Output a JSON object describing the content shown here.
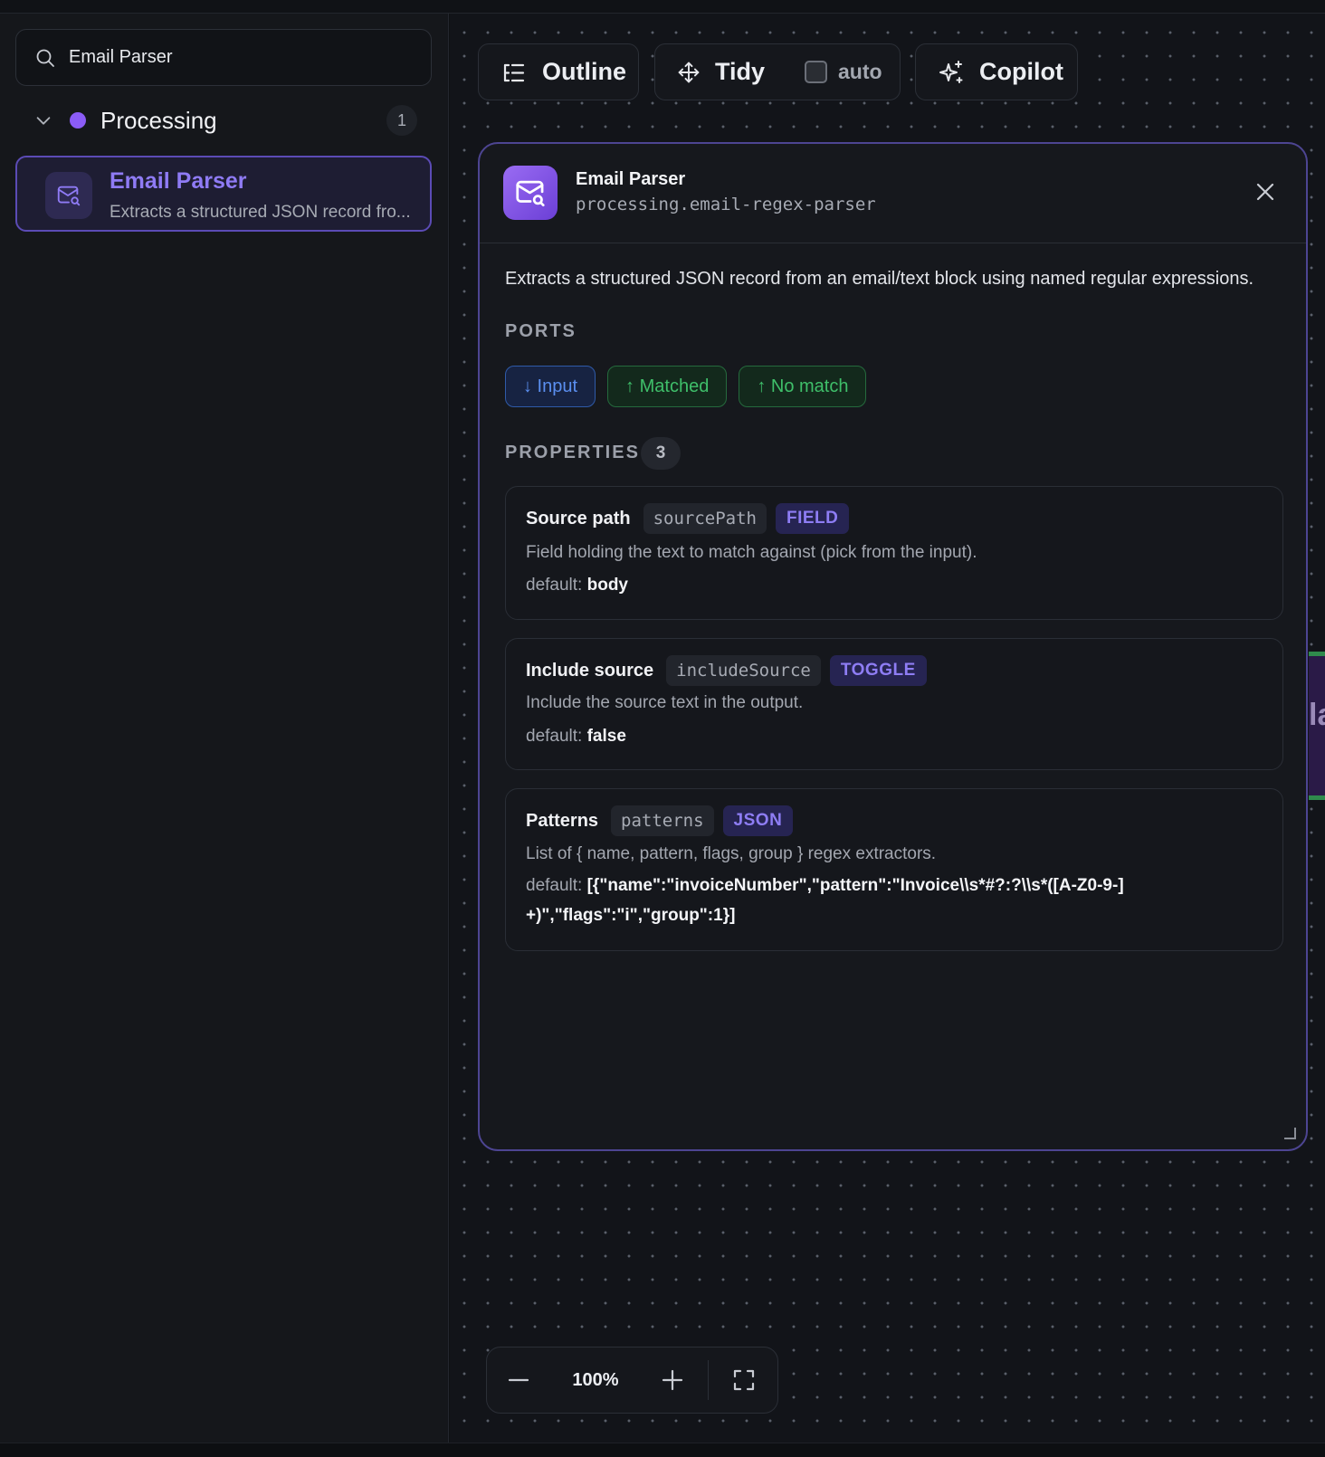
{
  "sidebar": {
    "search": {
      "value": "Email Parser",
      "icon": "search-icon"
    },
    "group": {
      "name": "Processing",
      "count": "1",
      "dot_color": "#8b5cf6"
    },
    "node": {
      "title": "Email Parser",
      "description": "Extracts a structured JSON record fro..."
    }
  },
  "toolbar": {
    "outline_label": "Outline",
    "tidy_label": "Tidy",
    "auto_label": "auto",
    "auto_checked": false,
    "copilot_label": "Copilot"
  },
  "peek_node": {
    "text": "la"
  },
  "panel": {
    "title": "Email Parser",
    "key": "processing.email-regex-parser",
    "description": "Extracts a structured JSON record from an email/text block using named regular expressions.",
    "ports_heading": "PORTS",
    "ports": [
      {
        "label": "↓ Input",
        "kind": "input"
      },
      {
        "label": "↑ Matched",
        "kind": "output"
      },
      {
        "label": "↑ No match",
        "kind": "output"
      }
    ],
    "properties_heading": "PROPERTIES",
    "properties_count": "3",
    "default_label": "default:",
    "properties": [
      {
        "label": "Source path",
        "key": "sourcePath",
        "type": "FIELD",
        "help": "Field holding the text to match against (pick from the input).",
        "default": "body"
      },
      {
        "label": "Include source",
        "key": "includeSource",
        "type": "TOGGLE",
        "help": "Include the source text in the output.",
        "default": "false"
      },
      {
        "label": "Patterns",
        "key": "patterns",
        "type": "JSON",
        "help": "List of { name, pattern, flags, group } regex extractors.",
        "default": "[{\"name\":\"invoiceNumber\",\"pattern\":\"Invoice\\\\s*#?:?\\\\s*([A-Z0-9-]+)\",\"flags\":\"i\",\"group\":1}]"
      }
    ]
  },
  "zoom": {
    "level": "100%"
  },
  "colors": {
    "accent": "#8b5cf6",
    "port_input": "#5b8ff0",
    "port_output": "#3fbf6a",
    "type_badge": "#8e7df4"
  }
}
